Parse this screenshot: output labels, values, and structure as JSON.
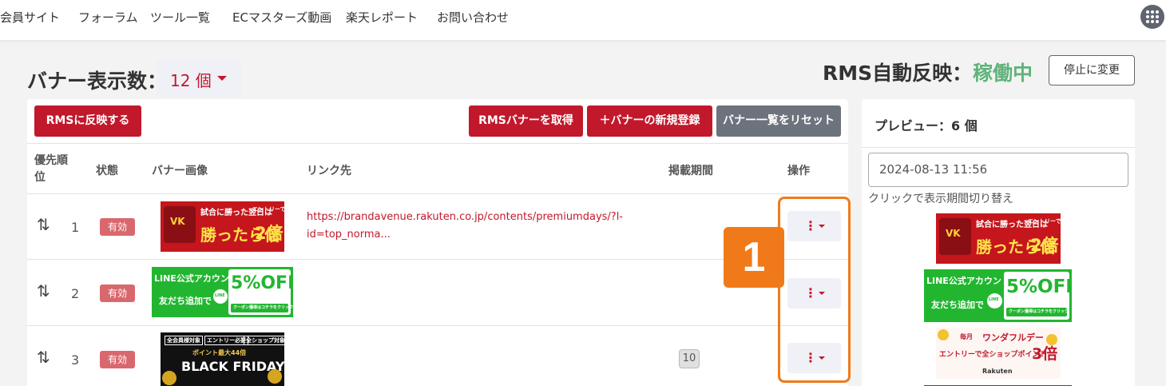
{
  "nav": {
    "items": [
      "会員サイト",
      "フォーラム",
      "ツール一覧",
      "ECマスターズ動画",
      "楽天レポート",
      "お問い合わせ"
    ],
    "apps_icon": "grid-apps-icon"
  },
  "header": {
    "banner_count_label": "バナー表示数：",
    "banner_count_value": "12 個",
    "rms_label": "RMS自動反映：",
    "rms_status": "稼働中",
    "stop_button": "停止に変更"
  },
  "toolbar": {
    "reflect_rms": "RMSに反映する",
    "get_rms_banner": "RMSバナーを取得",
    "new_banner": "＋バナーの新規登録",
    "reset_list": "バナー一覧をリセット"
  },
  "table": {
    "headers": {
      "priority_line1": "優先順",
      "priority_line2": "位",
      "status": "状態",
      "image": "バナー画像",
      "link": "リンク先",
      "period": "掲載期間",
      "ops": "操作"
    },
    "rows": [
      {
        "rank": "1",
        "status": "有効",
        "link": "https://brandavenue.rakuten.co.jp/contents/premiumdays/?l-id=top_norma...",
        "period": "",
        "banner": {
          "main": "勝ったら倍",
          "sub1": "試合に勝った翌日は",
          "sub2": "エントリーでポイント",
          "mult": "2倍"
        }
      },
      {
        "rank": "2",
        "status": "有効",
        "link": "",
        "period": "",
        "banner": {
          "main": "LINE公式アカウント",
          "sub1": "友だち追加で",
          "off": "5%OFF",
          "note": "クーポン獲得はコチラをクリック",
          "line": "LINE"
        }
      },
      {
        "rank": "3",
        "status": "有効",
        "link": "",
        "period": "10",
        "banner": {
          "tag1": "全会員様対象",
          "tag2": "エントリー必要",
          "tag3": "全ショップ対象",
          "sub1": "ポイント最大44倍",
          "main": "BLACK FRIDAY"
        }
      }
    ]
  },
  "preview": {
    "title": "プレビュー：6 個",
    "date": "2024-08-13 11:56",
    "hint": "クリックで表示期間切り替え",
    "banner3": {
      "top": "毎月",
      "brand": "ワンダフルデー",
      "main": "エントリーで全ショップポイント",
      "mult": "3倍",
      "logo": "Rakuten"
    }
  },
  "annotation": {
    "marker": "1"
  },
  "colors": {
    "accent_red": "#c2182b",
    "status_green": "#5fb37a",
    "marker_orange": "#f07a1a",
    "badge_red": "#d9686e"
  }
}
